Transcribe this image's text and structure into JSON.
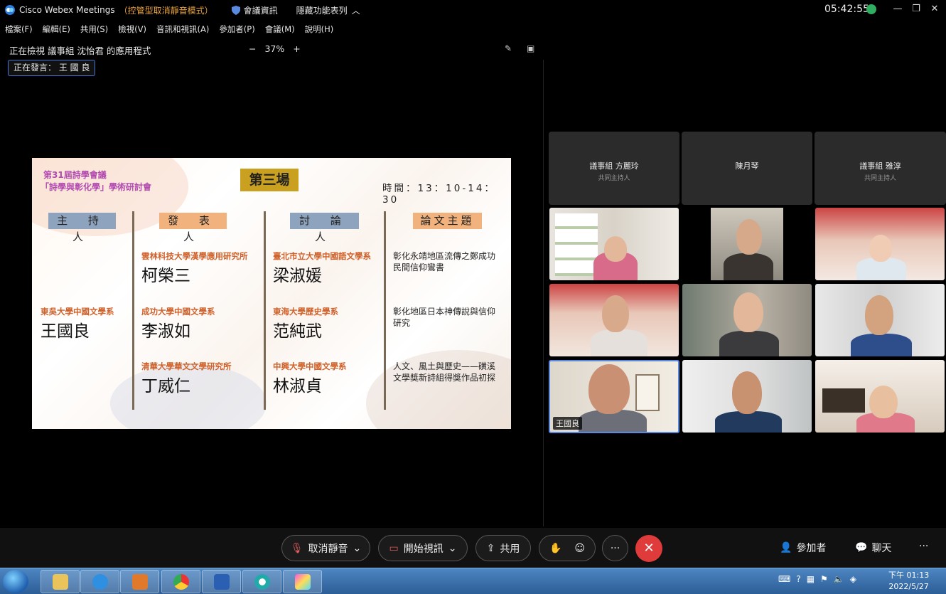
{
  "titlebar": {
    "app_name": "Cisco Webex Meetings",
    "mode": "（控管型取消靜音模式）",
    "meeting_info": "會議資訊",
    "hide_toolbar": "隱藏功能表列",
    "clock": "05:42:55"
  },
  "menu": [
    "檔案(F)",
    "編輯(E)",
    "共用(S)",
    "檢視(V)",
    "音訊和視訊(A)",
    "參加者(P)",
    "會議(M)",
    "說明(H)"
  ],
  "viewing": {
    "text": "正在檢視 議事組 沈怡君 的應用程式",
    "zoom_minus": "−",
    "zoom": "37%",
    "zoom_plus": "+",
    "speaking": "正在發言： 王 國 良"
  },
  "slide": {
    "conf_line1": "第31屆詩學會議",
    "conf_line2": "「詩學與彰化學」學術研討會",
    "session": "第三場",
    "time": "時間：13：10-14：30",
    "headers": [
      "主 持 人",
      "發 表 人",
      "討 論 人",
      "論文主題"
    ],
    "chair": {
      "aff": "東吳大學中國文學系",
      "name": "王國良"
    },
    "presenters": [
      {
        "aff": "雲林科技大學漢學應用研究所",
        "name": "柯榮三"
      },
      {
        "aff": "成功大學中國文學系",
        "name": "李淑如"
      },
      {
        "aff": "清華大學華文文學研究所",
        "name": "丁威仁"
      }
    ],
    "discussants": [
      {
        "aff": "臺北市立大學中國語文學系",
        "name": "梁淑媛"
      },
      {
        "aff": "東海大學歷史學系",
        "name": "范純武"
      },
      {
        "aff": "中興大學中國文學系",
        "name": "林淑貞"
      }
    ],
    "topics": [
      "彰化永靖地區流傳之鄭成功民間信仰鸞書",
      "彰化地區日本神傳說與信仰研究",
      "人文、風土與歷史——磺溪文學獎新詩組得獎作品初探"
    ]
  },
  "participants": {
    "no_video": [
      {
        "name": "議事組 方麗玲",
        "role": "共同主持人"
      },
      {
        "name": "陳月琴",
        "role": ""
      },
      {
        "name": "議事組 雅淳",
        "role": "共同主持人"
      }
    ],
    "active_speaker": "王國良"
  },
  "controls": {
    "unmute": "取消靜音",
    "start_video": "開始視訊",
    "share": "共用",
    "participants": "參加者",
    "chat": "聊天",
    "more": "···"
  },
  "taskbar": {
    "time_line1": "下午 01:13",
    "time_line2": "2022/5/27"
  },
  "colors": {
    "accent": "#5a8ae0",
    "end_call": "#e03b3b",
    "mode_text": "#e8a23b"
  }
}
